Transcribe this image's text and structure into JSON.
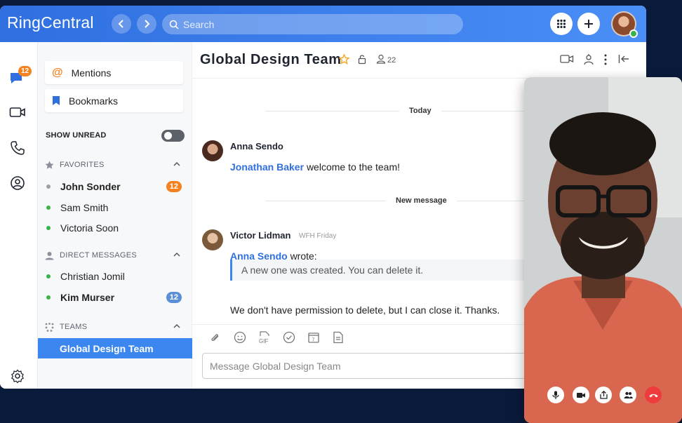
{
  "app": {
    "brand": "RingCentral"
  },
  "search": {
    "placeholder": "Search"
  },
  "rail": {
    "messages_badge": "12"
  },
  "sidebar": {
    "mentions": "Mentions",
    "bookmarks": "Bookmarks",
    "show_unread": "SHOW UNREAD",
    "favorites": {
      "label": "FAVORITES",
      "items": [
        {
          "name": "John Sonder",
          "count": "12",
          "presence": "#9aa0a8"
        },
        {
          "name": "Sam Smith",
          "presence": "#38b24a"
        },
        {
          "name": "Victoria Soon",
          "presence": "#38b24a"
        }
      ]
    },
    "direct": {
      "label": "DIRECT MESSAGES",
      "items": [
        {
          "name": "Christian Jomil",
          "presence": "#38b24a"
        },
        {
          "name": "Kim Murser",
          "count": "12",
          "presence": "#38b24a"
        }
      ]
    },
    "teams": {
      "label": "TEAMS",
      "selected": "Global Design Team"
    }
  },
  "chat": {
    "title": "Global Design Team",
    "member_count": "22",
    "divider_today": "Today",
    "divider_new": "New message",
    "messages": [
      {
        "author": "Anna Sendo",
        "mention": "Jonathan Baker",
        "text": "welcome to the team!"
      },
      {
        "author": "Victor Lidman",
        "status": "WFH Friday",
        "mention": "Anna Sendo",
        "text": "wrote:",
        "quote": "A new one was created. You can delete it.",
        "reply": "We don't have permission to delete, but I can close it. Thanks."
      }
    ],
    "composer_placeholder": "Message Global Design Team",
    "gif_label": "GIF",
    "calendar_day": "7"
  },
  "colors": {
    "accent": "#3c86f0",
    "badge_orange": "#f58220",
    "badge_blue": "#5a8fd6",
    "end_call": "#ee3c3c"
  }
}
